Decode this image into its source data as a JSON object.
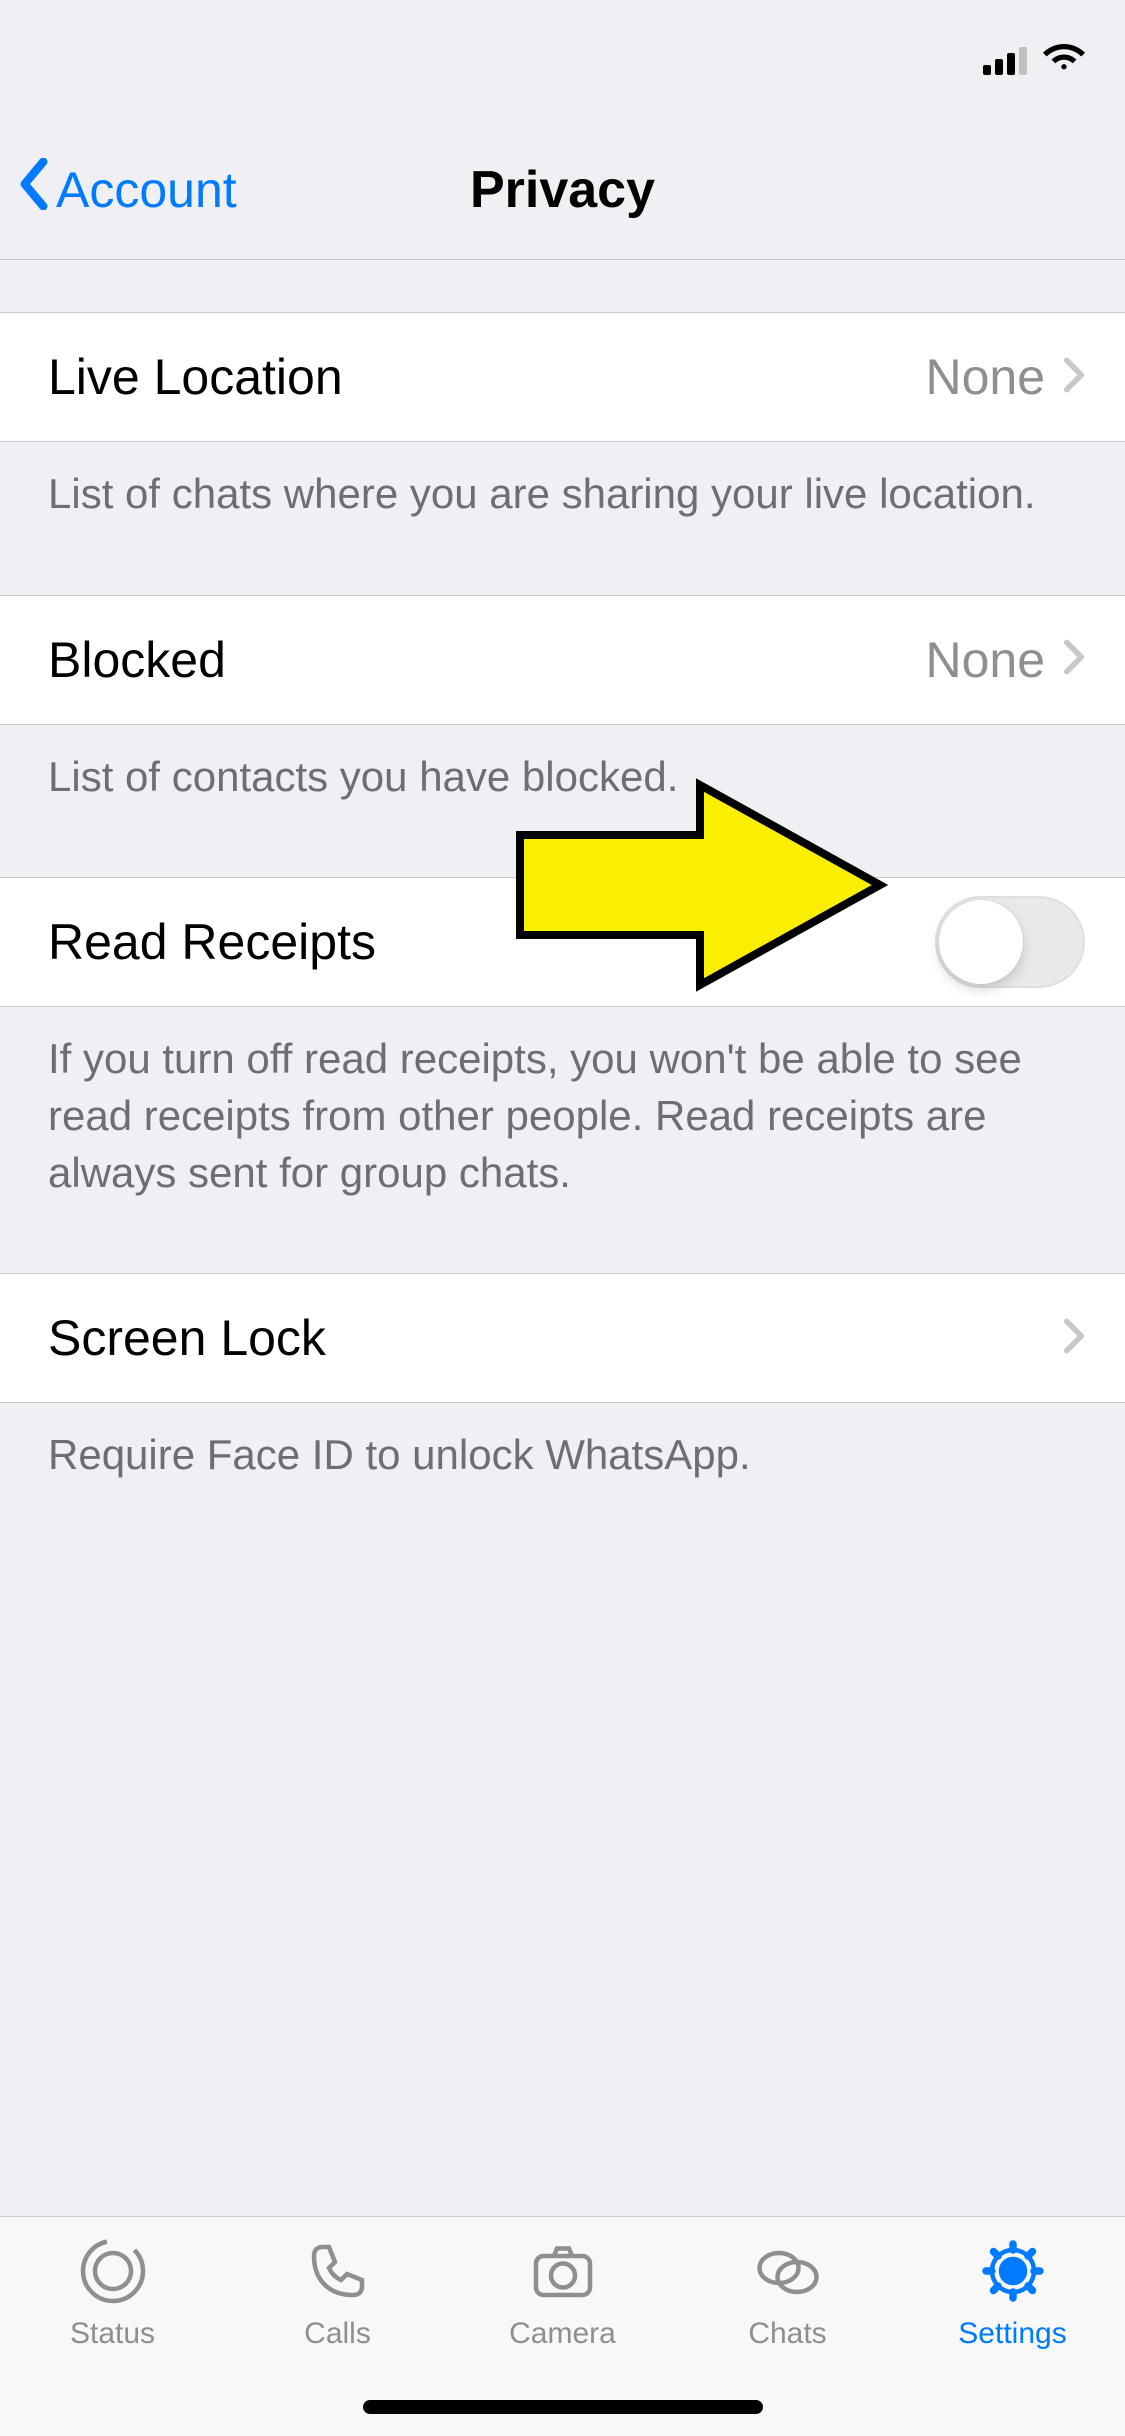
{
  "nav": {
    "back_label": "Account",
    "title": "Privacy"
  },
  "rows": {
    "live_location": {
      "label": "Live Location",
      "value": "None",
      "footer": "List of chats where you are sharing your live location."
    },
    "blocked": {
      "label": "Blocked",
      "value": "None",
      "footer": "List of contacts you have blocked."
    },
    "read_receipts": {
      "label": "Read Receipts",
      "footer": "If you turn off read receipts, you won't be able to see read receipts from other people. Read receipts are always sent for group chats."
    },
    "screen_lock": {
      "label": "Screen Lock",
      "footer": "Require Face ID to unlock WhatsApp."
    }
  },
  "tabbar": {
    "status": "Status",
    "calls": "Calls",
    "camera": "Camera",
    "chats": "Chats",
    "settings": "Settings"
  }
}
